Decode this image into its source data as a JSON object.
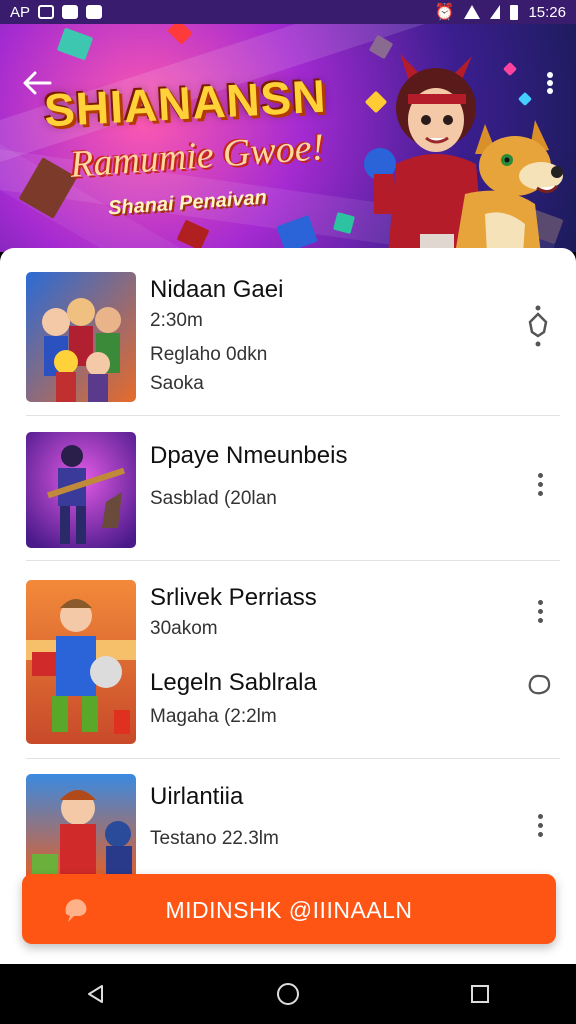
{
  "status_bar": {
    "left_text": "AP",
    "time": "15:26",
    "icons": [
      "notification-square-icon",
      "image-icon",
      "image-icon",
      "alarm-icon",
      "wifi-icon",
      "signal-icon",
      "battery-icon"
    ]
  },
  "banner": {
    "title": "SHIANANSN",
    "subtitle": "Ramumie Gwoe!",
    "tagline": "Shanai Penaivan",
    "back_icon": "arrow-left-icon",
    "overflow_icon": "more-vertical-icon"
  },
  "items": [
    {
      "title": "Nidaan Gaei",
      "lines": [
        "2:30m",
        "Reglaho 0dkn",
        "Saoka"
      ],
      "action_icon": "settings-gear-icon"
    },
    {
      "title": "Dpaye Nmeunbeis",
      "lines": [
        "Sasblad (20lan"
      ],
      "action_icon": "more-vertical-icon"
    },
    {
      "title": "Srlivek Perriass",
      "lines": [
        "30akom"
      ],
      "action_icon": "more-vertical-icon"
    },
    {
      "title": "Legeln Sablrala",
      "lines": [
        "Magaha (2:2lm"
      ],
      "action_icon": "chat-bubble-icon"
    },
    {
      "title": "Uirlantiia",
      "lines": [
        "Testano 22.3lm"
      ],
      "action_icon": "more-vertical-icon"
    }
  ],
  "cta": {
    "label": "MIDINSHK @IIINAALN",
    "icon": "bell-icon",
    "color": "#ff5514"
  },
  "nav": {
    "back_icon": "back-triangle-icon",
    "home_icon": "home-circle-icon",
    "recents_icon": "recents-square-icon"
  }
}
